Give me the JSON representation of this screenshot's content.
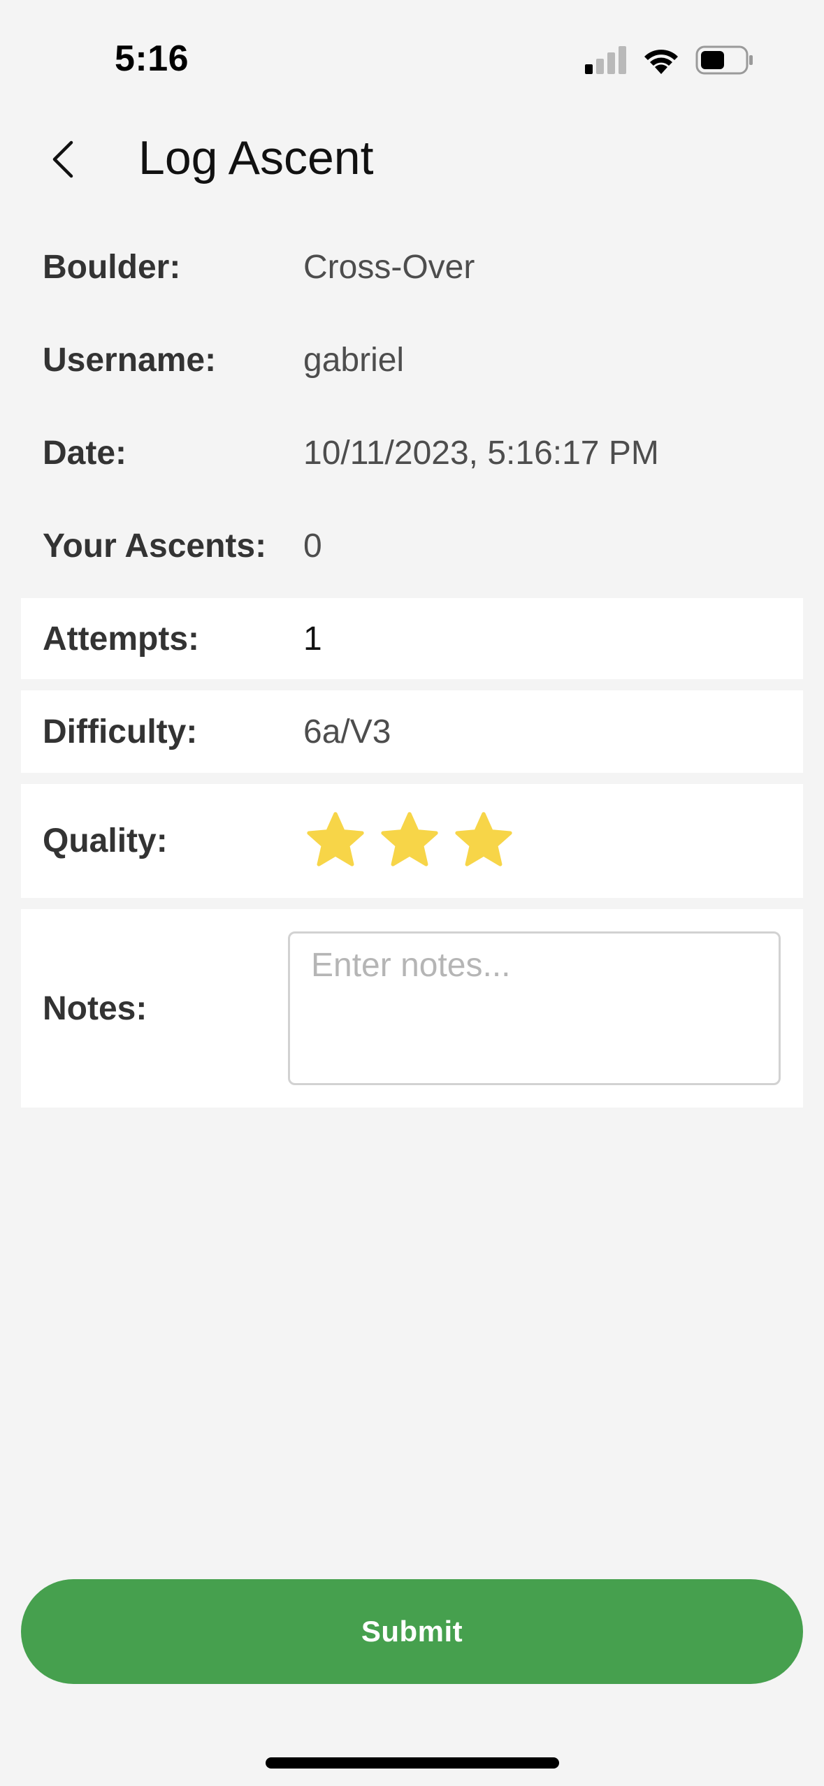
{
  "status_bar": {
    "time": "5:16",
    "battery_level": 0.55
  },
  "header": {
    "title": "Log Ascent"
  },
  "fields": {
    "boulder_label": "Boulder:",
    "boulder_value": "Cross-Over",
    "username_label": "Username:",
    "username_value": "gabriel",
    "date_label": "Date:",
    "date_value": "10/11/2023, 5:16:17 PM",
    "ascents_label": "Your Ascents:",
    "ascents_value": "0",
    "attempts_label": "Attempts:",
    "attempts_value": "1",
    "difficulty_label": "Difficulty:",
    "difficulty_value": "6a/V3",
    "quality_label": "Quality:",
    "quality_rating": 3,
    "notes_label": "Notes:",
    "notes_placeholder": "Enter notes..."
  },
  "submit_label": "Submit",
  "colors": {
    "background": "#f4f4f4",
    "card": "#ffffff",
    "accent_green": "#46a04e",
    "star_yellow": "#f7d548"
  },
  "icons": [
    "back-chevron-icon",
    "signal-icon",
    "wifi-icon",
    "battery-icon",
    "star-icon"
  ]
}
